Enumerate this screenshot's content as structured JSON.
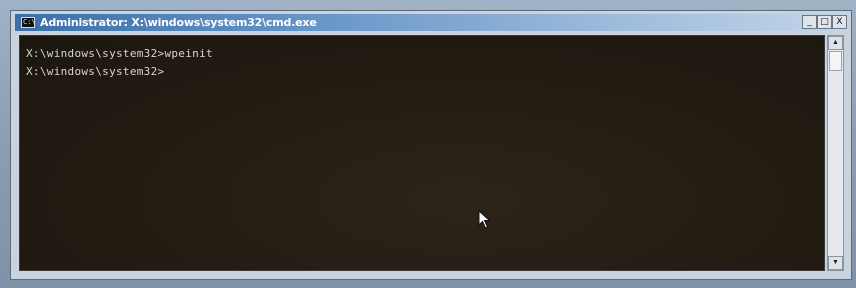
{
  "window": {
    "title": "Administrator: X:\\windows\\system32\\cmd.exe",
    "icon": "cmd-icon",
    "controls": {
      "minimize": "_",
      "maximize": "□",
      "close": "X"
    }
  },
  "console": {
    "lines": [
      "X:\\windows\\system32>wpeinit",
      "X:\\windows\\system32>"
    ]
  },
  "scrollbar": {
    "up_arrow": "▲",
    "down_arrow": "▼"
  },
  "colors": {
    "console_background": "#231c13",
    "console_text": "#d9d4cc",
    "titlebar_active": "#3c6fa8"
  }
}
